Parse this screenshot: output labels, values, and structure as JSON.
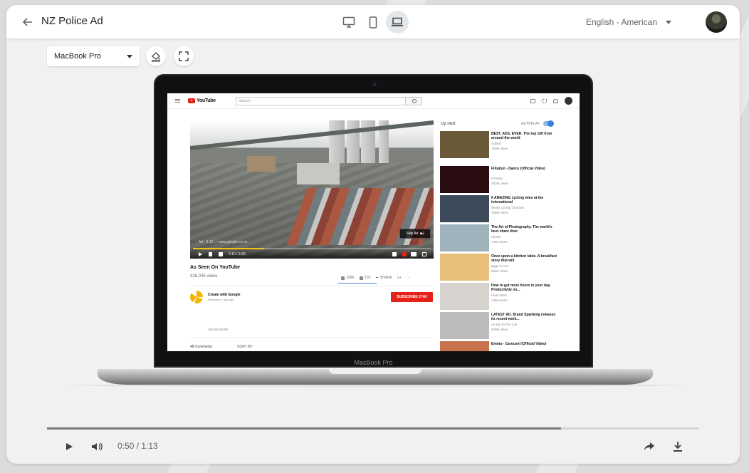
{
  "header": {
    "title": "NZ Police Ad",
    "language": "English - American",
    "device_modes": [
      "desktop-icon",
      "phone-icon",
      "laptop-icon"
    ],
    "active_mode": "laptop-icon"
  },
  "toolbar": {
    "device_select_value": "MacBook Pro"
  },
  "laptop": {
    "model_label": "MacBook Pro"
  },
  "youtube": {
    "search_placeholder": "Search",
    "ad_text": "Ad · 3:10 ⓘ  www.google.co.nz",
    "skip_ad": "Skip Ad",
    "video_time": "0:10 / 3:20",
    "video_title": "As Seen On YouTube",
    "views": "326,045 views",
    "likes": "158K",
    "dislikes": "21K",
    "share": "SHARE",
    "channel_name": "Create with Google",
    "published": "Published 1 day ago",
    "subscribe": "SUBSCRIBE  274K",
    "show_more": "SHOW MORE",
    "comments_count": "48 Comments",
    "sort_by": "SORT BY",
    "up_next": "Up next",
    "autoplay": "AUTOPLAY",
    "recommendations": [
      {
        "title": "BEST. ADS. EVER. The top 100 from around the world",
        "channel": "Adland",
        "views": "780M views",
        "color": "#6b5a3a"
      },
      {
        "title": "FIXation - Dance (Official Video)",
        "channel": "FIXation",
        "views": "202M views",
        "color": "#2a0d10"
      },
      {
        "title": "6 AMAZING cycling wins at the international",
        "channel": "World Cycling Channel",
        "views": "780M views",
        "color": "#3d4a5a"
      },
      {
        "title": "The Art of Photography. The world's best share their",
        "channel": "Clicker",
        "views": "7.5M views",
        "color": "#9fb3bd"
      },
      {
        "title": "Once upon a kitchen table. A breakfast story that will",
        "channel": "Eggs in love",
        "views": "500K views",
        "color": "#e8c07a"
      },
      {
        "title": "How to get more hours in your day. Productivity on...",
        "channel": "Hello Work",
        "views": "1.5M views",
        "color": "#d6d3cf"
      },
      {
        "title": "LATEST AD. Brand Spanking releases its recent work...",
        "channel": "Ad Me To The List",
        "views": "500M views",
        "color": "#bcbcbc"
      },
      {
        "title": "Emma - Carousel (Official Video)",
        "channel": "Flat Records",
        "views": "",
        "color": "#c9724e"
      }
    ]
  },
  "player": {
    "time_display": "0:50 / 1:13",
    "progress_percent": 78.8
  },
  "colors": {
    "youtube_red": "#e62117",
    "accent_blue": "#3b82d6"
  }
}
